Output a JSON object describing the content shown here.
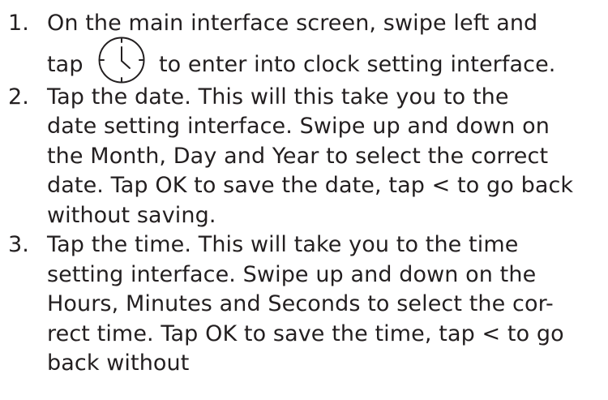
{
  "steps": [
    {
      "number": "1.",
      "lines": [
        "On the main interface screen, swipe left and",
        "tap",
        "to enter into clock setting interface."
      ],
      "icon": "clock-icon"
    },
    {
      "number": "2.",
      "lines": [
        "Tap the date. This will this take you to the",
        "date setting interface. Swipe up and down on",
        "the Month, Day and Year to select the correct",
        "date. Tap OK to save the date, tap < to go back",
        "without saving."
      ]
    },
    {
      "number": "3.",
      "lines": [
        "Tap the time. This will take you to the time",
        "setting interface. Swipe up and down on the",
        "Hours, Minutes and Seconds to select the cor-",
        "rect time. Tap OK to save the time, tap < to go",
        "back without"
      ]
    }
  ],
  "colors": {
    "text": "#231f20",
    "background": "#ffffff"
  }
}
